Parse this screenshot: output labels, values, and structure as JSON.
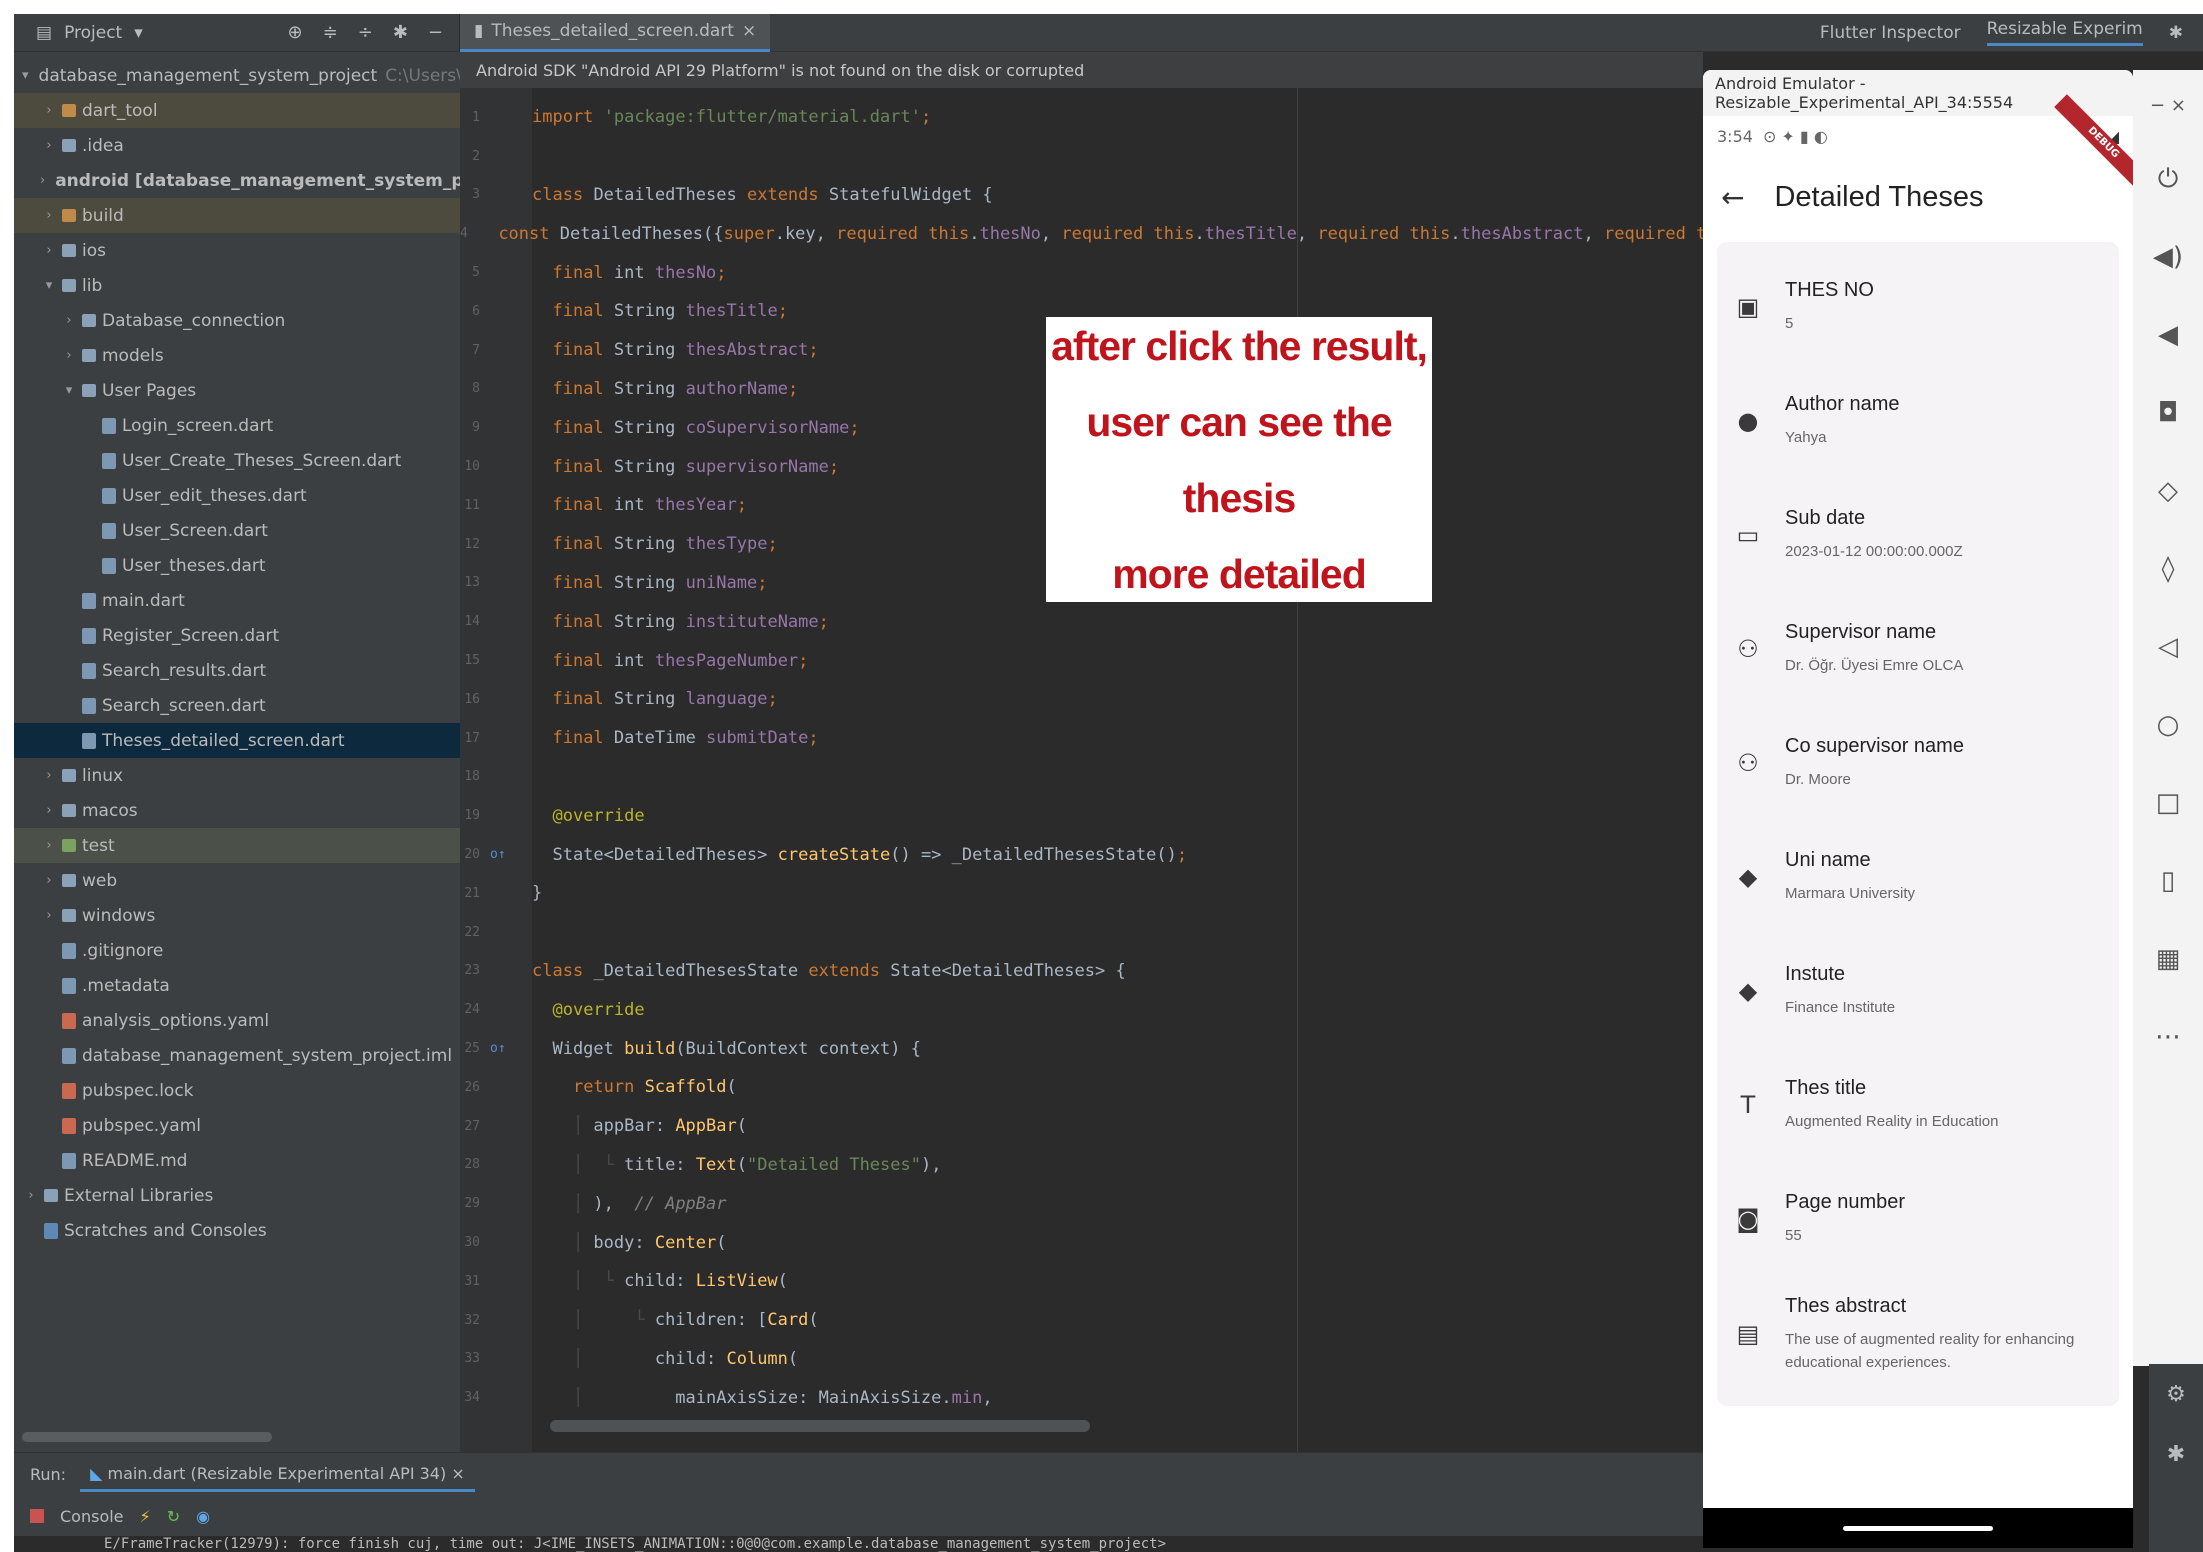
{
  "topbar": {
    "project_label": "Project",
    "tab_label": "Theses_detailed_screen.dart",
    "flutter_inspector": "Flutter Inspector",
    "device_label": "Resizable Experim"
  },
  "tree": {
    "root_label": "database_management_system_project",
    "root_path": "C:\\Users\\Mehme\\",
    "items": [
      {
        "label": "dart_tool"
      },
      {
        "label": ".idea"
      },
      {
        "label": "android [database_management_system_project_android]"
      },
      {
        "label": "build"
      },
      {
        "label": "ios"
      },
      {
        "label": "lib"
      },
      {
        "label": "Database_connection"
      },
      {
        "label": "models"
      },
      {
        "label": "User Pages"
      },
      {
        "label": "Login_screen.dart"
      },
      {
        "label": "User_Create_Theses_Screen.dart"
      },
      {
        "label": "User_edit_theses.dart"
      },
      {
        "label": "User_Screen.dart"
      },
      {
        "label": "User_theses.dart"
      },
      {
        "label": "main.dart"
      },
      {
        "label": "Register_Screen.dart"
      },
      {
        "label": "Search_results.dart"
      },
      {
        "label": "Search_screen.dart"
      },
      {
        "label": "Theses_detailed_screen.dart"
      },
      {
        "label": "linux"
      },
      {
        "label": "macos"
      },
      {
        "label": "test"
      },
      {
        "label": "web"
      },
      {
        "label": "windows"
      },
      {
        "label": ".gitignore"
      },
      {
        "label": ".metadata"
      },
      {
        "label": "analysis_options.yaml"
      },
      {
        "label": "database_management_system_project.iml"
      },
      {
        "label": "pubspec.lock"
      },
      {
        "label": "pubspec.yaml"
      },
      {
        "label": "README.md"
      },
      {
        "label": "External Libraries"
      },
      {
        "label": "Scratches and Consoles"
      }
    ]
  },
  "editor": {
    "banner": "Android SDK \"Android API 29 Platform\" is not found on the disk or corrupted"
  },
  "note": {
    "line1": "after click the result,",
    "line2": "user can see the thesis",
    "line3": "more detailed"
  },
  "emulator": {
    "window_title": "Android Emulator - Resizable_Experimental_API_34:5554",
    "status_time": "3:54",
    "appbar_title": "Detailed Theses",
    "fields": [
      {
        "label": "THES NO",
        "value": "5"
      },
      {
        "label": "Author name",
        "value": "Yahya"
      },
      {
        "label": "Sub date",
        "value": "2023-01-12 00:00:00.000Z"
      },
      {
        "label": "Supervisor name",
        "value": "Dr. Öğr. Üyesi Emre OLCA"
      },
      {
        "label": "Co supervisor name",
        "value": "Dr. Moore"
      },
      {
        "label": "Uni name",
        "value": "Marmara University"
      },
      {
        "label": "Instute",
        "value": "Finance Institute"
      },
      {
        "label": "Thes title",
        "value": "Augmented Reality in Education"
      },
      {
        "label": "Page number",
        "value": "55"
      },
      {
        "label": "Thes abstract",
        "value": "The use of augmented reality for enhancing educational experiences."
      }
    ]
  },
  "runbar": {
    "run_label": "Run:",
    "run_tab": "main.dart (Resizable Experimental API 34)",
    "console_label": "Console",
    "log_text": "E/FrameTracker(12979): force finish cuj, time out: J<IME_INSETS_ANIMATION::0@0@com.example.database_management_system_project>"
  }
}
